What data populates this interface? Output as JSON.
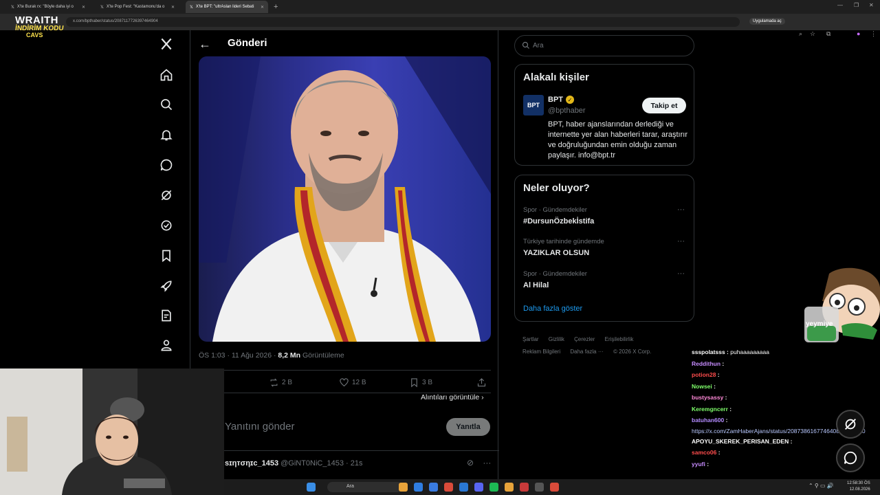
{
  "browser": {
    "tabs": [
      {
        "label": "X'te Burak rx: \"Böyle daha iyi o",
        "active": false
      },
      {
        "label": "X'te Pop Fest: \"Kastamonu'da o",
        "active": false
      },
      {
        "label": "X'te BPT: \"ultrAslan lideri Sebati",
        "active": true
      }
    ],
    "url": "x.com/bpthaber/status/2087117726397464904",
    "app_chip": "Uygulamada aç"
  },
  "overlay": {
    "logo_line1": "WRAITH",
    "logo_line2": "İNDİRİM KODU",
    "logo_line3": "CAVS",
    "mascot_text": "yeymiye"
  },
  "nav": {
    "items": [
      "x-logo",
      "home",
      "explore",
      "notifications",
      "messages",
      "grok",
      "premium",
      "bookmarks",
      "jobs",
      "articles",
      "profile"
    ]
  },
  "post": {
    "header_title": "Gönderi",
    "meta_time": "ÖS 1:03 · 11 Ağu 2026 · ",
    "meta_views_value": "8,2 Mn",
    "meta_views_label": " Görüntüleme",
    "reposts": "2 B",
    "likes": "12 B",
    "bookmarks": "3 B",
    "quotes_link": "Alıntıları görüntüle",
    "reply_placeholder": "Yanıtını gönder",
    "reply_button": "Yanıtla"
  },
  "comment": {
    "name": "ѕɪηтσηɪc_1453",
    "handle": "@GiNT0NiC_1453 · 21s"
  },
  "sidebar": {
    "search_placeholder": "Ara",
    "related": {
      "title": "Alakalı kişiler",
      "name": "BPT",
      "handle": "@bpthaber",
      "follow": "Takip et",
      "avatar_text": "BPT",
      "bio": "BPT, haber ajanslarından derlediği ve internette yer alan haberleri tarar, araştırır ve doğruluğundan emin olduğu zaman paylaşır. info@bpt.tr"
    },
    "trends": {
      "title": "Neler oluyor?",
      "items": [
        {
          "category": "Spor · Gündemdekiler",
          "name": "#DursunÖzbekİstifa"
        },
        {
          "category": "Türkiye tarihinde gündemde",
          "name": "YAZIKLAR OLSUN"
        },
        {
          "category": "Spor · Gündemdekiler",
          "name": "Al Hilal"
        }
      ],
      "show_more": "Daha fazla göster"
    },
    "footer": [
      "Şartlar",
      "Gizlilik",
      "Çerezler",
      "Erişilebilirlik",
      "Reklam Bilgileri",
      "Daha fazla ···",
      "© 2026 X Corp."
    ]
  },
  "chat": [
    {
      "user": "ssspolatsss",
      "text": "puhaaaaaaaaa",
      "color": "#ffffff"
    },
    {
      "user": "Reddithun",
      "text": "",
      "color": "#c78cff"
    },
    {
      "user": "potion28",
      "text": "",
      "color": "#ff4d4d"
    },
    {
      "user": "Nowsei",
      "text": "",
      "color": "#7fff6b"
    },
    {
      "user": "bustysassy",
      "text": "",
      "color": "#ff8ad8"
    },
    {
      "user": "Keremgncerr",
      "text": "",
      "color": "#7fff6b"
    },
    {
      "user": "batuhan600",
      "text": "",
      "color": "#b48cff"
    },
    {
      "user": "",
      "text": "https://x.com/ZamHaberAjans/status/2087386167746408804?s=20",
      "color": "#b8c8ff"
    },
    {
      "user": "APOYU_SKEREK_PERISAN_EDEN",
      "text": "",
      "color": "#ffffff"
    },
    {
      "user": "samco06",
      "text": "",
      "color": "#ff4d4d"
    },
    {
      "user": "yyufi",
      "text": "",
      "color": "#c78cff"
    }
  ],
  "taskbar": {
    "search": "Ara",
    "time": "12:58:30 ÖS",
    "date": "12.08.2026"
  },
  "colors": {
    "accent": "#1d9bf0",
    "background": "#000000",
    "border": "#2f3336"
  }
}
